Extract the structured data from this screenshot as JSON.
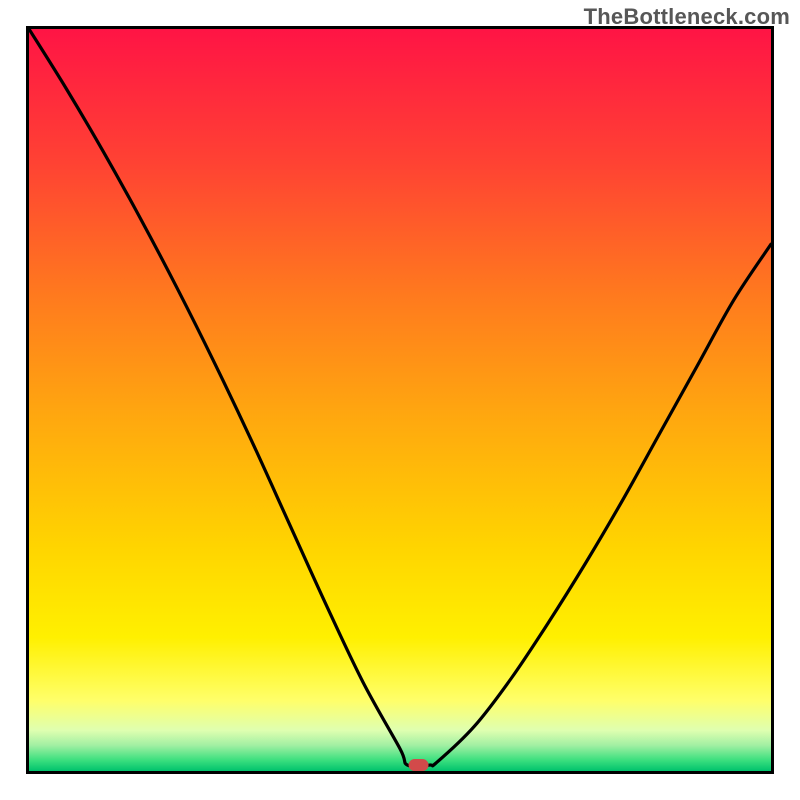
{
  "watermark": "TheBottleneck.com",
  "chart_data": {
    "type": "line",
    "title": "",
    "xlabel": "",
    "ylabel": "",
    "xlim": [
      0,
      100
    ],
    "ylim": [
      0,
      100
    ],
    "x": [
      0,
      5,
      10,
      15,
      20,
      25,
      30,
      35,
      40,
      45,
      50,
      51,
      54,
      55,
      60,
      65,
      70,
      75,
      80,
      85,
      90,
      95,
      100
    ],
    "values": [
      100,
      92,
      83.5,
      74.5,
      65,
      55,
      44.5,
      33.5,
      22.5,
      12,
      3,
      0.8,
      0.8,
      1.2,
      6,
      12.5,
      20,
      28,
      36.5,
      45.5,
      54.5,
      63.5,
      71
    ],
    "background": {
      "type": "vertical_gradient",
      "stops": [
        {
          "pos": 0.0,
          "color": "#ff1445"
        },
        {
          "pos": 0.18,
          "color": "#ff4233"
        },
        {
          "pos": 0.36,
          "color": "#ff7a1e"
        },
        {
          "pos": 0.52,
          "color": "#ffa70f"
        },
        {
          "pos": 0.7,
          "color": "#ffd500"
        },
        {
          "pos": 0.82,
          "color": "#fff000"
        },
        {
          "pos": 0.905,
          "color": "#ffff6a"
        },
        {
          "pos": 0.945,
          "color": "#dfffb0"
        },
        {
          "pos": 0.965,
          "color": "#a3f0a3"
        },
        {
          "pos": 0.985,
          "color": "#3de07f"
        },
        {
          "pos": 1.0,
          "color": "#00c26d"
        }
      ]
    },
    "marker": {
      "x": 52.5,
      "y": 0.8,
      "color": "#d24a4a",
      "shape": "pill"
    }
  }
}
